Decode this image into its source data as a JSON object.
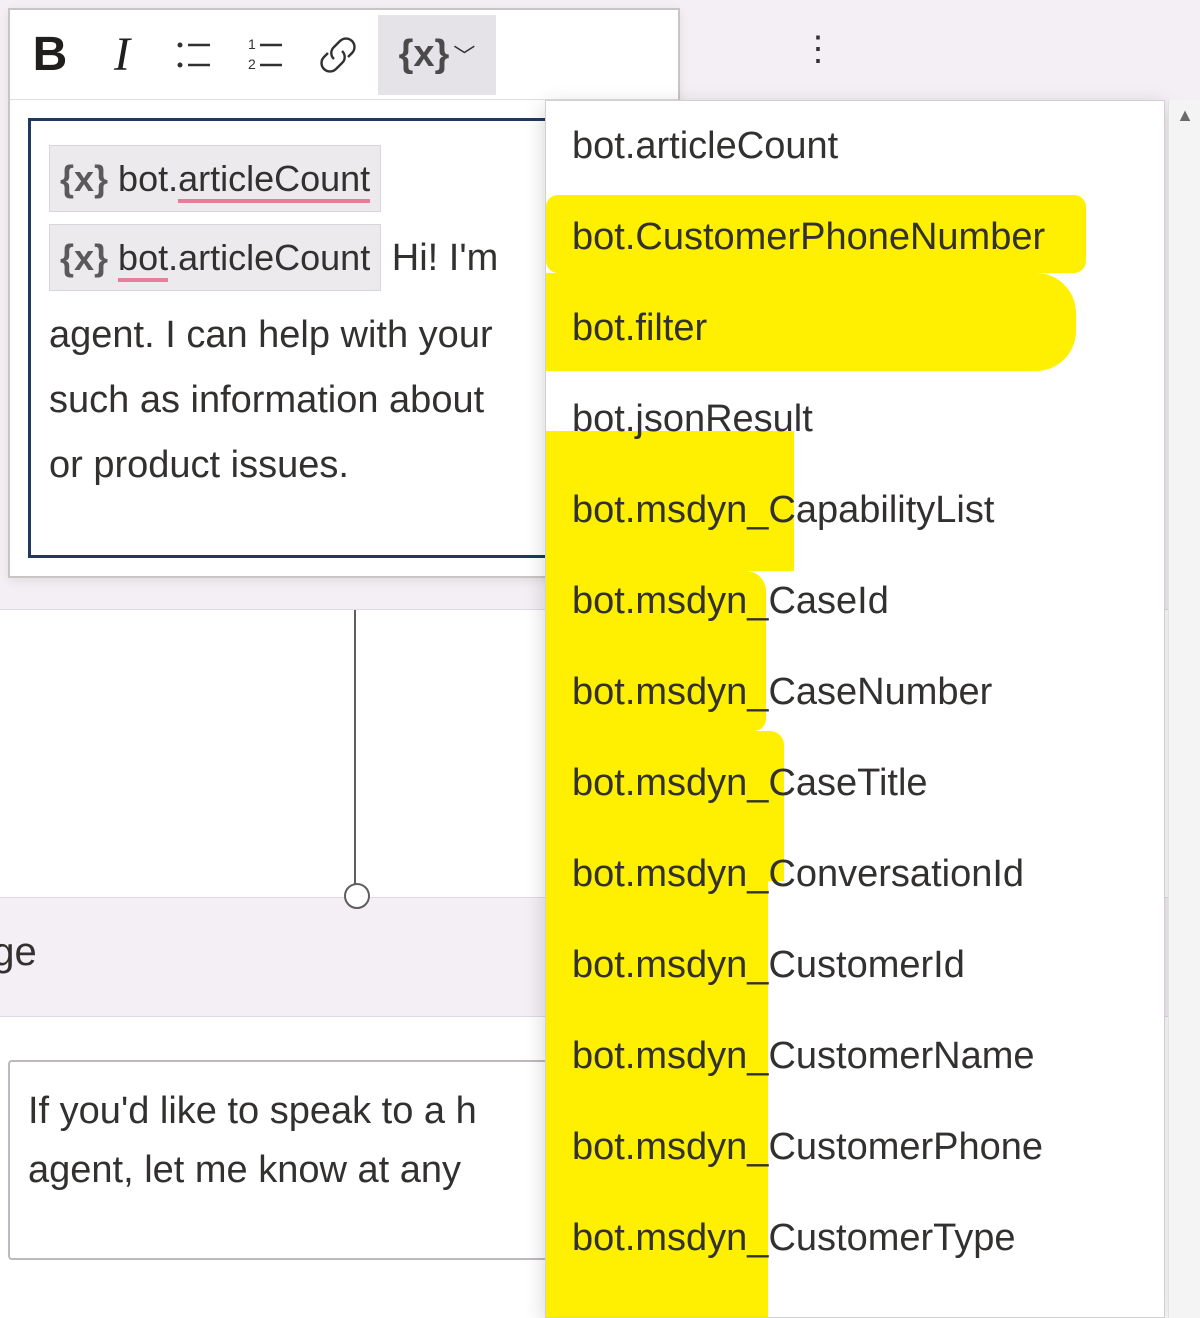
{
  "toolbar": {
    "bold_label": "B",
    "italic_label": "I",
    "var_label": "{x}"
  },
  "more_button": "⋮",
  "editor": {
    "chip_vx": "{x}",
    "chip1_text": "bot.articleCount",
    "chip2_text": "bot.articleCount",
    "line2_suffix": " Hi! I'm",
    "line3": "agent. I can help with your",
    "line4": "such as information about",
    "line5": "or product issues."
  },
  "lower_section_label": "age",
  "lower_box_line1": "If you'd like to speak to a h",
  "lower_box_line2": "agent, let me know at any",
  "dropdown": {
    "items": [
      "bot.articleCount",
      "bot.CustomerPhoneNumber",
      "bot.filter",
      "bot.jsonResult",
      "bot.msdyn_CapabilityList",
      "bot.msdyn_CaseId",
      "bot.msdyn_CaseNumber",
      "bot.msdyn_CaseTitle",
      "bot.msdyn_ConversationId",
      "bot.msdyn_CustomerId",
      "bot.msdyn_CustomerName",
      "bot.msdyn_CustomerPhone",
      "bot.msdyn_CustomerType"
    ]
  },
  "scrollbar": {
    "up": "▲"
  }
}
